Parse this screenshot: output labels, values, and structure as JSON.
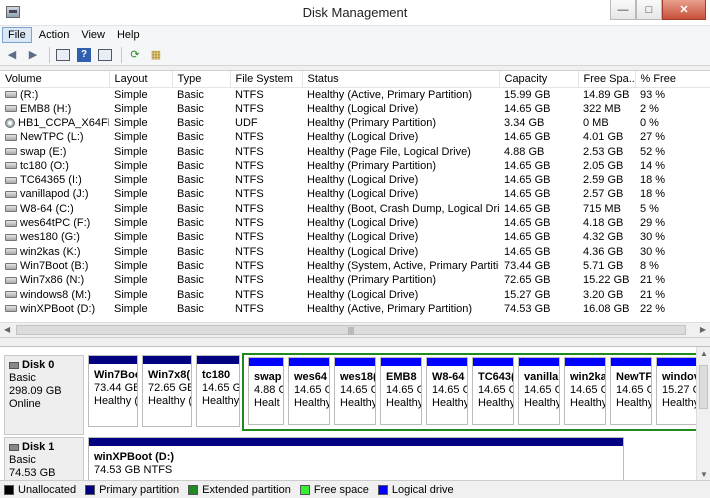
{
  "window": {
    "title": "Disk Management"
  },
  "menu": [
    {
      "label": "File"
    },
    {
      "label": "Action"
    },
    {
      "label": "View"
    },
    {
      "label": "Help"
    }
  ],
  "toolbar": {
    "icons": [
      "back-arrow-icon",
      "forward-arrow-icon",
      "properties-icon",
      "help-icon",
      "console-tree-icon",
      "refresh-icon",
      "rescan-disks-icon"
    ]
  },
  "volume_list": {
    "columns": [
      "Volume",
      "Layout",
      "Type",
      "File System",
      "Status",
      "Capacity",
      "Free Spa...",
      "% Free"
    ],
    "rows": [
      [
        "(R:)",
        "Simple",
        "Basic",
        "NTFS",
        "Healthy (Active, Primary Partition)",
        "15.99 GB",
        "14.89 GB",
        "93 %"
      ],
      [
        "EMB8 (H:)",
        "Simple",
        "Basic",
        "NTFS",
        "Healthy (Logical Drive)",
        "14.65 GB",
        "322 MB",
        "2 %"
      ],
      [
        "HB1_CCPA_X64FR...",
        "Simple",
        "Basic",
        "UDF",
        "Healthy (Primary Partition)",
        "3.34 GB",
        "0 MB",
        "0 %"
      ],
      [
        "NewTPC (L:)",
        "Simple",
        "Basic",
        "NTFS",
        "Healthy (Logical Drive)",
        "14.65 GB",
        "4.01 GB",
        "27 %"
      ],
      [
        "swap (E:)",
        "Simple",
        "Basic",
        "NTFS",
        "Healthy (Page File, Logical Drive)",
        "4.88 GB",
        "2.53 GB",
        "52 %"
      ],
      [
        "tc180 (O:)",
        "Simple",
        "Basic",
        "NTFS",
        "Healthy (Primary Partition)",
        "14.65 GB",
        "2.05 GB",
        "14 %"
      ],
      [
        "TC64365 (I:)",
        "Simple",
        "Basic",
        "NTFS",
        "Healthy (Logical Drive)",
        "14.65 GB",
        "2.59 GB",
        "18 %"
      ],
      [
        "vanillapod (J:)",
        "Simple",
        "Basic",
        "NTFS",
        "Healthy (Logical Drive)",
        "14.65 GB",
        "2.57 GB",
        "18 %"
      ],
      [
        "W8-64 (C:)",
        "Simple",
        "Basic",
        "NTFS",
        "Healthy (Boot, Crash Dump, Logical Drive)",
        "14.65 GB",
        "715 MB",
        "5 %"
      ],
      [
        "wes64tPC (F:)",
        "Simple",
        "Basic",
        "NTFS",
        "Healthy (Logical Drive)",
        "14.65 GB",
        "4.18 GB",
        "29 %"
      ],
      [
        "wes180 (G:)",
        "Simple",
        "Basic",
        "NTFS",
        "Healthy (Logical Drive)",
        "14.65 GB",
        "4.32 GB",
        "30 %"
      ],
      [
        "win2kas (K:)",
        "Simple",
        "Basic",
        "NTFS",
        "Healthy (Logical Drive)",
        "14.65 GB",
        "4.36 GB",
        "30 %"
      ],
      [
        "Win7Boot (B:)",
        "Simple",
        "Basic",
        "NTFS",
        "Healthy (System, Active, Primary Partition)",
        "73.44 GB",
        "5.71 GB",
        "8 %"
      ],
      [
        "Win7x86 (N:)",
        "Simple",
        "Basic",
        "NTFS",
        "Healthy (Primary Partition)",
        "72.65 GB",
        "15.22 GB",
        "21 %"
      ],
      [
        "windows8 (M:)",
        "Simple",
        "Basic",
        "NTFS",
        "Healthy (Logical Drive)",
        "15.27 GB",
        "3.20 GB",
        "21 %"
      ],
      [
        "winXPBoot (D:)",
        "Simple",
        "Basic",
        "NTFS",
        "Healthy (Active, Primary Partition)",
        "74.53 GB",
        "16.08 GB",
        "22 %"
      ]
    ],
    "scroll_grip": "|||"
  },
  "disks": [
    {
      "name": "Disk 0",
      "type": "Basic",
      "size": "298.09 GB",
      "state": "Online",
      "partitions": [
        {
          "name": "Win7Boo",
          "size": "73.44 GB",
          "status": "Healthy (",
          "kind": "primary"
        },
        {
          "name": "Win7x8(",
          "size": "72.65 GB",
          "status": "Healthy (",
          "kind": "primary"
        },
        {
          "name": "tc180",
          "size": "14.65 G",
          "status": "Healthy",
          "kind": "primary"
        },
        {
          "name": "swap",
          "size": "4.88 G",
          "status": "Healt",
          "kind": "logical"
        },
        {
          "name": "wes64",
          "size": "14.65 G",
          "status": "Healthy",
          "kind": "logical"
        },
        {
          "name": "wes18(",
          "size": "14.65 G",
          "status": "Healthy",
          "kind": "logical"
        },
        {
          "name": "EMB8",
          "size": "14.65 G",
          "status": "Healthy",
          "kind": "logical"
        },
        {
          "name": "W8-64",
          "size": "14.65 G",
          "status": "Healthy",
          "kind": "logical"
        },
        {
          "name": "TC643(",
          "size": "14.65 G",
          "status": "Healthy",
          "kind": "logical"
        },
        {
          "name": "vanillap",
          "size": "14.65 G",
          "status": "Healthy",
          "kind": "logical"
        },
        {
          "name": "win2ka",
          "size": "14.65 G",
          "status": "Healthy",
          "kind": "logical"
        },
        {
          "name": "NewTF",
          "size": "14.65 G",
          "status": "Healthy",
          "kind": "logical"
        },
        {
          "name": "windov",
          "size": "15.27 G",
          "status": "Healthy",
          "kind": "logical"
        }
      ]
    },
    {
      "name": "Disk 1",
      "type": "Basic",
      "size": "74.53 GB",
      "state": "",
      "partitions": [
        {
          "name": "winXPBoot (D:)",
          "size": "74.53 GB NTFS",
          "status": "",
          "kind": "primary"
        }
      ]
    }
  ],
  "legend": [
    {
      "label": "Unallocated",
      "color": "#000000"
    },
    {
      "label": "Primary partition",
      "color": "#000080"
    },
    {
      "label": "Extended partition",
      "color": "#1f8a1f"
    },
    {
      "label": "Free space",
      "color": "#33ee33"
    },
    {
      "label": "Logical drive",
      "color": "#0000ff"
    }
  ]
}
